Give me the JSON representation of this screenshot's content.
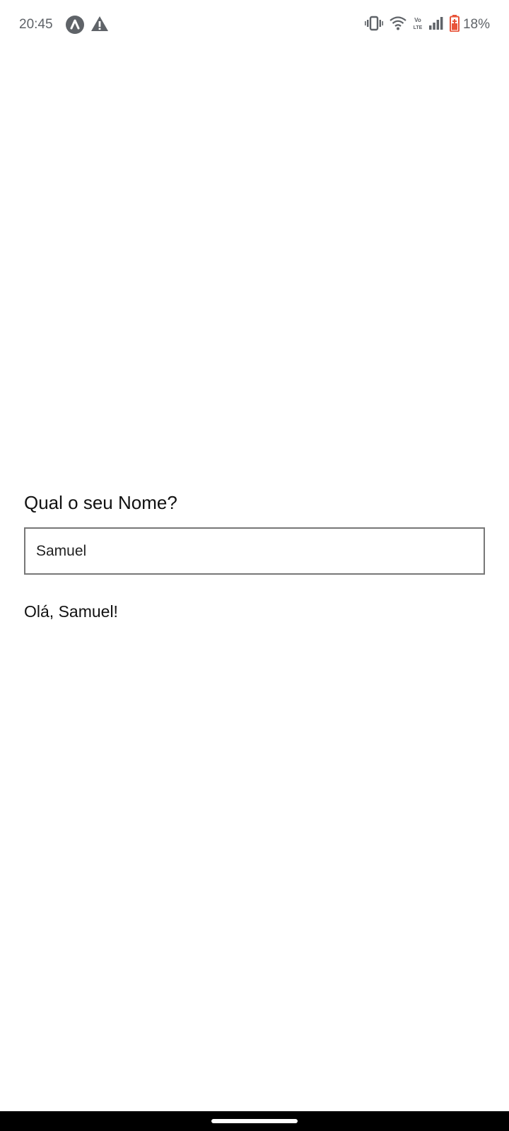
{
  "status_bar": {
    "time": "20:45",
    "left_icons": [
      "app-notification-icon",
      "warning-icon"
    ],
    "right_icons": [
      "vibrate-icon",
      "wifi-icon",
      "volte-icon",
      "signal-icon",
      "battery-low-icon"
    ],
    "battery_percent": "18%",
    "battery_color": "#e8543a"
  },
  "form": {
    "question": "Qual o seu Nome?",
    "name_value": "Samuel",
    "greeting": "Olá, Samuel!"
  },
  "nav": {
    "handle": "gesture-handle"
  }
}
